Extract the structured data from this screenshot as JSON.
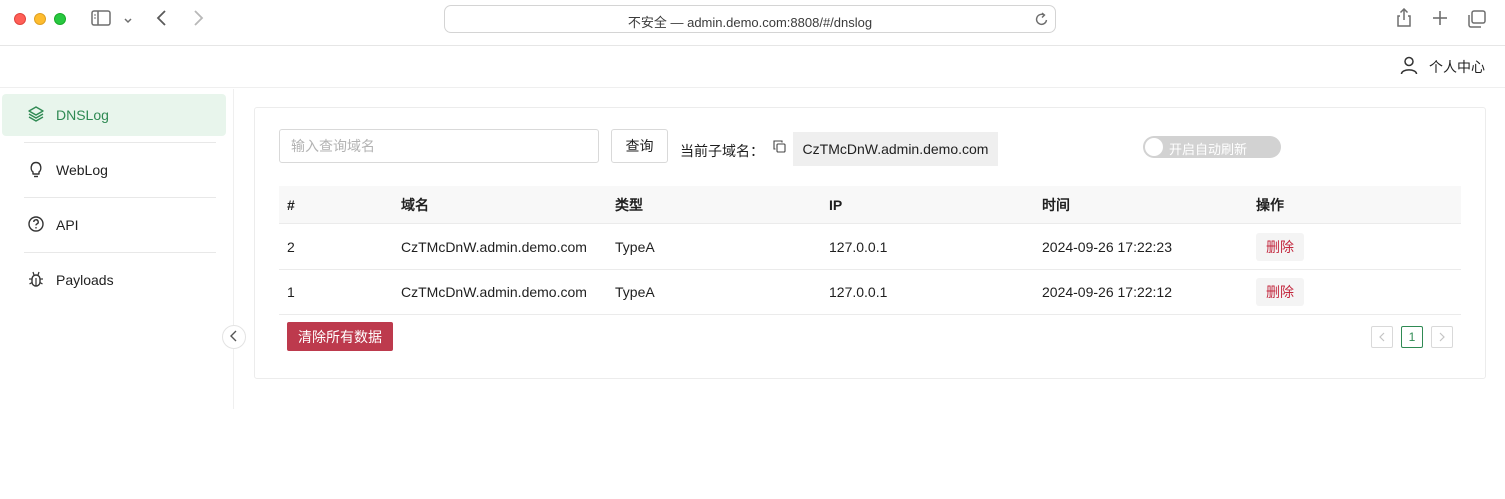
{
  "browser": {
    "url": "不安全 — admin.demo.com:8808/#/dnslog"
  },
  "header": {
    "profile_label": "个人中心",
    "profile_icon": "user-icon"
  },
  "sidebar": {
    "items": [
      {
        "label": "DNSLog",
        "icon": "layers-icon",
        "active": true
      },
      {
        "label": "WebLog",
        "icon": "lightbulb-icon",
        "active": false
      },
      {
        "label": "API",
        "icon": "help-circle-icon",
        "active": false
      },
      {
        "label": "Payloads",
        "icon": "bug-icon",
        "active": false
      }
    ]
  },
  "toolbar": {
    "search_placeholder": "输入查询域名",
    "search_value": "",
    "query_label": "查询",
    "subdomain_label": "当前子域名：",
    "subdomain_value": "CzTMcDnW.admin.demo.com",
    "auto_refresh_label": "开启自动刷新",
    "auto_refresh_on": false
  },
  "table": {
    "columns": [
      "#",
      "域名",
      "类型",
      "IP",
      "时间",
      "操作"
    ],
    "rows": [
      {
        "id": "2",
        "domain": "CzTMcDnW.admin.demo.com",
        "type": "TypeA",
        "ip": "127.0.0.1",
        "time": "2024-09-26 17:22:23",
        "action": "删除"
      },
      {
        "id": "1",
        "domain": "CzTMcDnW.admin.demo.com",
        "type": "TypeA",
        "ip": "127.0.0.1",
        "time": "2024-09-26 17:22:12",
        "action": "删除"
      }
    ]
  },
  "footer": {
    "clear_label": "清除所有数据",
    "current_page": "1"
  },
  "colors": {
    "accent": "#2f8a53",
    "danger": "#bd3a4d"
  }
}
